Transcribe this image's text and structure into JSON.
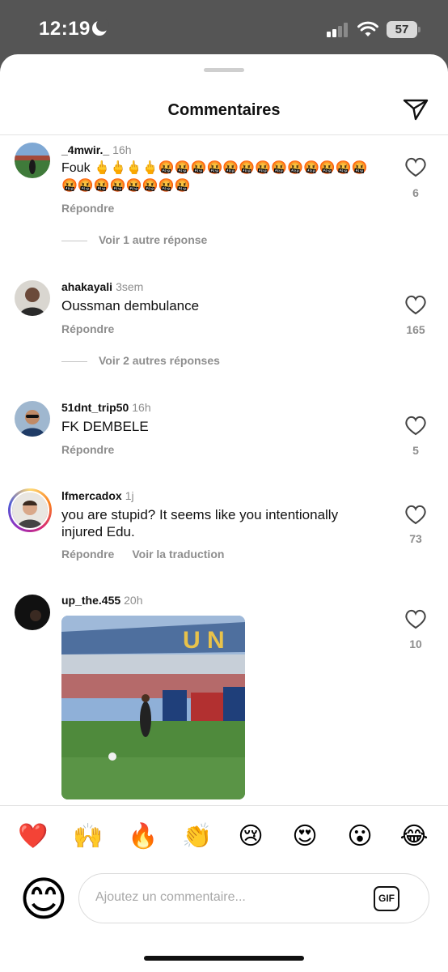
{
  "status_bar": {
    "time": "12:19",
    "battery": "57"
  },
  "header": {
    "title": "Commentaires"
  },
  "comments": [
    {
      "username": "_4mwir._",
      "time": "16h",
      "text": "Fouk 🖕🖕🖕🖕🤬🤬🤬🤬🤬🤬🤬🤬🤬🤬🤬🤬🤬🤬🤬🤬🤬🤬🤬🤬🤬",
      "reply_label": "Répondre",
      "likes": "6",
      "more_replies": "Voir 1 autre réponse"
    },
    {
      "username": "ahakayali",
      "time": "3sem",
      "text": "Oussman dembulance",
      "reply_label": "Répondre",
      "likes": "165",
      "more_replies": "Voir 2 autres réponses"
    },
    {
      "username": "51dnt_trip50",
      "time": "16h",
      "text": "FK DEMBELE",
      "reply_label": "Répondre",
      "likes": "5"
    },
    {
      "username": "lfmercadox",
      "time": "1j",
      "text": "you are stupid?  It seems like you intentionally injured Edu.",
      "reply_label": "Répondre",
      "translate_label": "Voir la traduction",
      "likes": "73"
    },
    {
      "username": "up_the.455",
      "time": "20h",
      "likes": "10"
    }
  ],
  "reactions": [
    "❤️",
    "🙌",
    "🔥",
    "👏",
    "😢",
    "😍",
    "😮",
    "😂"
  ],
  "composer": {
    "placeholder": "Ajoutez un commentaire...",
    "gif_label": "GIF",
    "avatar_emoji": "😊"
  }
}
